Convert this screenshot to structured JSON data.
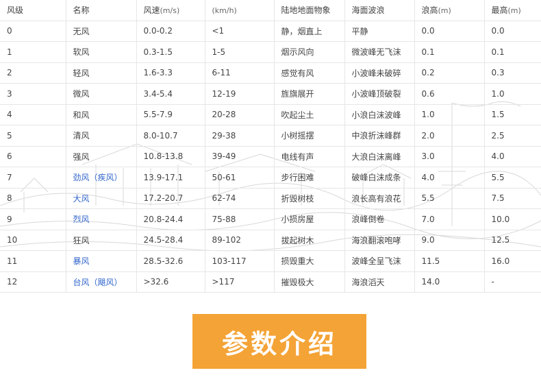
{
  "table": {
    "headers": [
      {
        "text": "风级",
        "unit": ""
      },
      {
        "text": "名称",
        "unit": ""
      },
      {
        "text": "风速",
        "unit": "(m/s)"
      },
      {
        "text": "",
        "unit": "(km/h)"
      },
      {
        "text": "陆地地面物象",
        "unit": ""
      },
      {
        "text": "海面波浪",
        "unit": ""
      },
      {
        "text": "浪高",
        "unit": "(m)"
      },
      {
        "text": "最高",
        "unit": "(m)"
      }
    ],
    "rows": [
      {
        "level": "0",
        "name": "无风",
        "name_extra": "",
        "link": false,
        "mps": "0.0-0.2",
        "kmh": "<1",
        "land": "静，烟直上",
        "sea": "平静",
        "wave": "0.0",
        "max": "0.0"
      },
      {
        "level": "1",
        "name": "软风",
        "name_extra": "",
        "link": false,
        "mps": "0.3-1.5",
        "kmh": "1-5",
        "land": "烟示风向",
        "sea": "微波峰无飞沫",
        "wave": "0.1",
        "max": "0.1"
      },
      {
        "level": "2",
        "name": "轻风",
        "name_extra": "",
        "link": false,
        "mps": "1.6-3.3",
        "kmh": "6-11",
        "land": "感觉有风",
        "sea": "小波峰未破碎",
        "wave": "0.2",
        "max": "0.3"
      },
      {
        "level": "3",
        "name": "微风",
        "name_extra": "",
        "link": false,
        "mps": "3.4-5.4",
        "kmh": "12-19",
        "land": "旌旗展开",
        "sea": "小波峰顶破裂",
        "wave": "0.6",
        "max": "1.0"
      },
      {
        "level": "4",
        "name": "和风",
        "name_extra": "",
        "link": false,
        "mps": "5.5-7.9",
        "kmh": "20-28",
        "land": "吹起尘土",
        "sea": "小浪白沫波峰",
        "wave": "1.0",
        "max": "1.5"
      },
      {
        "level": "5",
        "name": "清风",
        "name_extra": "",
        "link": false,
        "mps": "8.0-10.7",
        "kmh": "29-38",
        "land": "小树摇摆",
        "sea": "中浪折沫峰群",
        "wave": "2.0",
        "max": "2.5"
      },
      {
        "level": "6",
        "name": "强风",
        "name_extra": "",
        "link": false,
        "mps": "10.8-13.8",
        "kmh": "39-49",
        "land": "电线有声",
        "sea": "大浪白沫离峰",
        "wave": "3.0",
        "max": "4.0"
      },
      {
        "level": "7",
        "name": "劲风",
        "name_extra": "（疾风）",
        "link": true,
        "mps": "13.9-17.1",
        "kmh": "50-61",
        "land": "步行困难",
        "sea": "破峰白沫成条",
        "wave": "4.0",
        "max": "5.5"
      },
      {
        "level": "8",
        "name": "大风",
        "name_extra": "",
        "link": true,
        "mps": "17.2-20.7",
        "kmh": "62-74",
        "land": "折毁树枝",
        "sea": "浪长高有浪花",
        "wave": "5.5",
        "max": "7.5"
      },
      {
        "level": "9",
        "name": "烈风",
        "name_extra": "",
        "link": true,
        "mps": "20.8-24.4",
        "kmh": "75-88",
        "land": "小损房屋",
        "sea": "浪峰倒卷",
        "wave": "7.0",
        "max": "10.0"
      },
      {
        "level": "10",
        "name": "狂风",
        "name_extra": "",
        "link": false,
        "mps": "24.5-28.4",
        "kmh": "89-102",
        "land": "拔起树木",
        "sea": "海浪翻滚咆哮",
        "wave": "9.0",
        "max": "12.5"
      },
      {
        "level": "11",
        "name": "暴风",
        "name_extra": "",
        "link": true,
        "mps": "28.5-32.6",
        "kmh": "103-117",
        "land": "损毁重大",
        "sea": "波峰全呈飞沫",
        "wave": "11.5",
        "max": "16.0"
      },
      {
        "level": "12",
        "name": "台风",
        "name_extra": "（飓风）",
        "link": true,
        "mps": ">32.6",
        "kmh": ">117",
        "land": "摧毁极大",
        "sea": "海浪滔天",
        "wave": "14.0",
        "max": "-"
      }
    ]
  },
  "banner": {
    "text": "参数介绍",
    "color": "#f4a336"
  },
  "colors": {
    "link": "#3366cc",
    "border": "#e6e6e6"
  }
}
